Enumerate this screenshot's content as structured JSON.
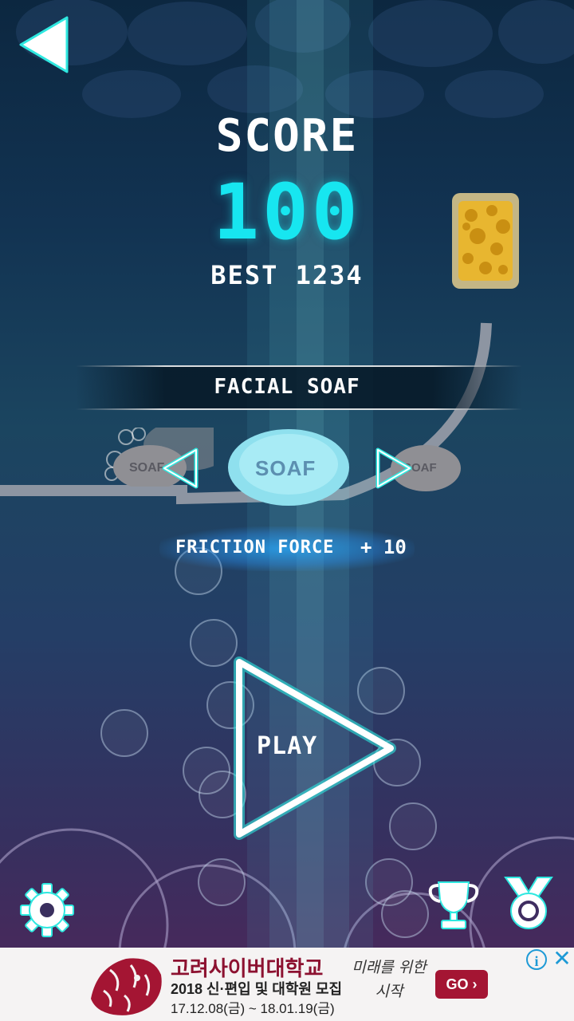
{
  "game": {
    "score_label": "SCORE",
    "score": "100",
    "best": "BEST 1234",
    "soap_name": "FACIAL SOAF",
    "soap_label": "SOAF",
    "friction_label": "FRICTION FORCE",
    "friction_value": "+ 10",
    "play_label": "PLAY"
  },
  "icons": {
    "back": "back-arrow-icon",
    "prev": "left-arrow-icon",
    "next": "right-arrow-icon",
    "settings": "gear-icon",
    "leaderboard": "trophy-icon",
    "achievements": "medal-icon",
    "sponge": "sponge-icon"
  },
  "ad": {
    "title": "고려사이버대학교",
    "subtitle": "2018 신·편입 및 대학원 모집",
    "dates": "17.12.08(금) ~ 18.01.19(금)",
    "slogan": "미래를 위한 시작",
    "go_label": "GO ›",
    "info": "i",
    "close": "✕"
  },
  "colors": {
    "accent": "#17e6f0",
    "glow": "#2fe8e0",
    "soap_blue": "#8fe0ee",
    "ad_brand": "#a41533"
  }
}
